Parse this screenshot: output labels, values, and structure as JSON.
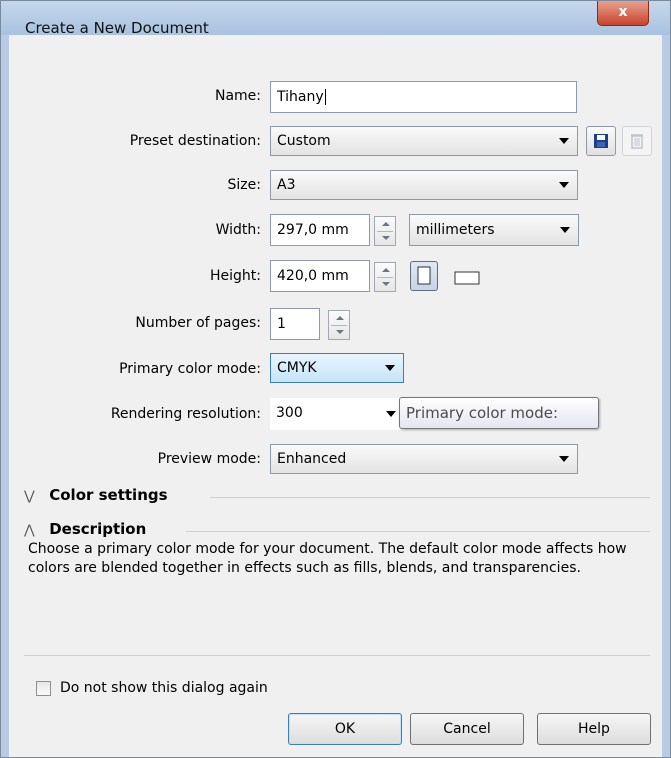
{
  "window": {
    "title": "Create a New Document",
    "close_glyph": "x"
  },
  "form": {
    "name": {
      "label": "Name:",
      "value": "Tihany"
    },
    "preset": {
      "label": "Preset destination:",
      "value": "Custom"
    },
    "size": {
      "label": "Size:",
      "value": "A3"
    },
    "width": {
      "label": "Width:",
      "value": "297,0 mm",
      "unit": "millimeters"
    },
    "height": {
      "label": "Height:",
      "value": "420,0 mm"
    },
    "pages": {
      "label": "Number of pages:",
      "value": "1"
    },
    "color_mode": {
      "label": "Primary color mode:",
      "value": "CMYK"
    },
    "resolution": {
      "label": "Rendering resolution:",
      "value": "300"
    },
    "preview": {
      "label": "Preview mode:",
      "value": "Enhanced"
    }
  },
  "tooltip": "Primary color mode:",
  "sections": {
    "color_settings": "Color settings",
    "description": "Description"
  },
  "description_text": "Choose a primary color mode for your document. The default color mode affects how colors are blended together in effects such as fills, blends, and transparencies.",
  "checkbox": {
    "label": "Do not show this dialog again",
    "checked": false
  },
  "buttons": {
    "ok": "OK",
    "cancel": "Cancel",
    "help": "Help"
  },
  "icons": [
    "save-icon",
    "delete-icon",
    "portrait-icon",
    "landscape-icon",
    "chevron-down-double-icon",
    "chevron-up-double-icon"
  ]
}
